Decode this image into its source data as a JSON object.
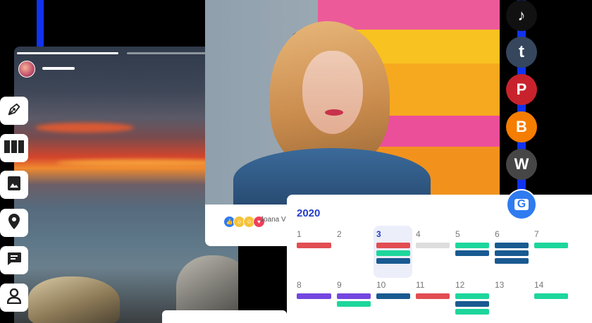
{
  "story": {
    "progress_segments": 2
  },
  "toolbar": {
    "items": [
      {
        "name": "pen-tool",
        "icon": "pen-icon"
      },
      {
        "name": "columns-tool",
        "icon": "columns-icon"
      },
      {
        "name": "image-tool",
        "icon": "image-icon"
      },
      {
        "name": "location-tool",
        "icon": "location-pin-icon"
      },
      {
        "name": "comment-tool",
        "icon": "comment-icon"
      },
      {
        "name": "profile-tool",
        "icon": "user-icon"
      }
    ]
  },
  "post": {
    "reaction_name": "Joana V"
  },
  "social": {
    "items": [
      {
        "name": "tiktok",
        "icon": "tiktok-icon",
        "glyph": "♪",
        "color": "#111111"
      },
      {
        "name": "tumblr",
        "icon": "tumblr-icon",
        "glyph": "t",
        "color": "#36465d"
      },
      {
        "name": "pinterest",
        "icon": "pinterest-icon",
        "glyph": "P",
        "color": "#c8232c"
      },
      {
        "name": "blogger",
        "icon": "blogger-icon",
        "glyph": "B",
        "color": "#f57d00"
      },
      {
        "name": "wordpress",
        "icon": "wordpress-icon",
        "glyph": "W",
        "color": "#464646"
      },
      {
        "name": "google-business",
        "icon": "google-business-icon",
        "glyph": "G",
        "color": "#2f7bf0"
      }
    ]
  },
  "calendar": {
    "year": "2020",
    "days": [
      "1",
      "2",
      "3",
      "4",
      "5",
      "6",
      "7",
      "8",
      "9",
      "10",
      "11",
      "12",
      "13",
      "14"
    ],
    "today": "3",
    "colors": {
      "red": "#e14d52",
      "green": "#1dd69c",
      "navy": "#195a91",
      "gray": "#dddddd",
      "purple": "#7447e0",
      "accent": "#2540c8"
    }
  }
}
